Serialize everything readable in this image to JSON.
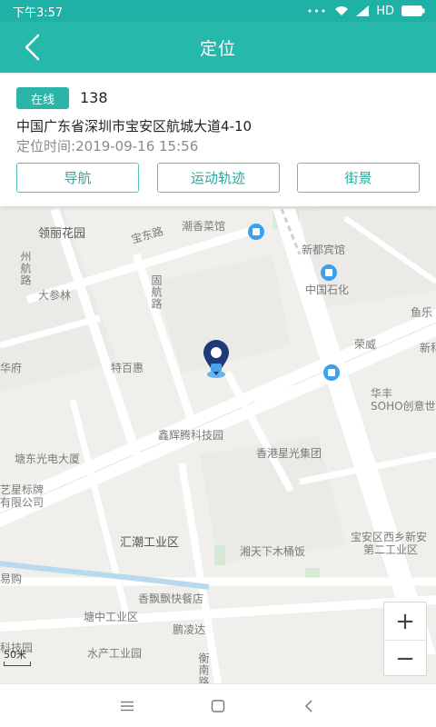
{
  "status_bar": {
    "time": "下午3:57",
    "dots": "•••",
    "network": "HD"
  },
  "header": {
    "title": "定位",
    "back_icon": "back-arrow-icon"
  },
  "device": {
    "status": "在线",
    "id": "138",
    "address": "中国广东省深圳市宝安区航城大道4-10",
    "time_label": "定位时间:",
    "time_value": "2019-09-16 15:56"
  },
  "actions": {
    "navigate": "导航",
    "track": "运动轨迹",
    "street_view": "街景"
  },
  "map": {
    "labels": {
      "lingli": "领丽花园",
      "baodong": "宝东路",
      "chaoxiang": "潮香菜馆",
      "xindu": "新都宾馆",
      "zhouhang": "州航路",
      "dashen": "大参林",
      "guohang": "固航路",
      "sinopec": "中国石化",
      "yule": "鱼乐",
      "rongwei": "荣威",
      "xinke": "新科",
      "tebaihui": "特百惠",
      "huafu": "华府",
      "huafeng": "华丰",
      "soho": "SOHO创意世",
      "xinhui": "鑫辉腾科技园",
      "xgstar": "香港星光集团",
      "tangdong": "塘东光电大厦",
      "yixing": "艺星标牌",
      "youxian": "有限公司",
      "huichao": "汇潮工业区",
      "xiangtian": "湘天下木桶饭",
      "baoan": "宝安区西乡新安",
      "dierind": "第二工业区",
      "shenfei": "香飘飘快餐店",
      "tangzhong": "塘中工业区",
      "pengling": "鹏凌达",
      "shuichan": "水产工业园",
      "kejiyuan": "科技园",
      "hengnan": "衡南路",
      "yige": "易购"
    },
    "scale": "50米",
    "zoom_in": "+",
    "zoom_out": "−"
  },
  "colors": {
    "primary": "#27b8ac",
    "status_bar": "#20b1a6",
    "badge": "#2ab5a8",
    "marker": "#1e3a78"
  }
}
